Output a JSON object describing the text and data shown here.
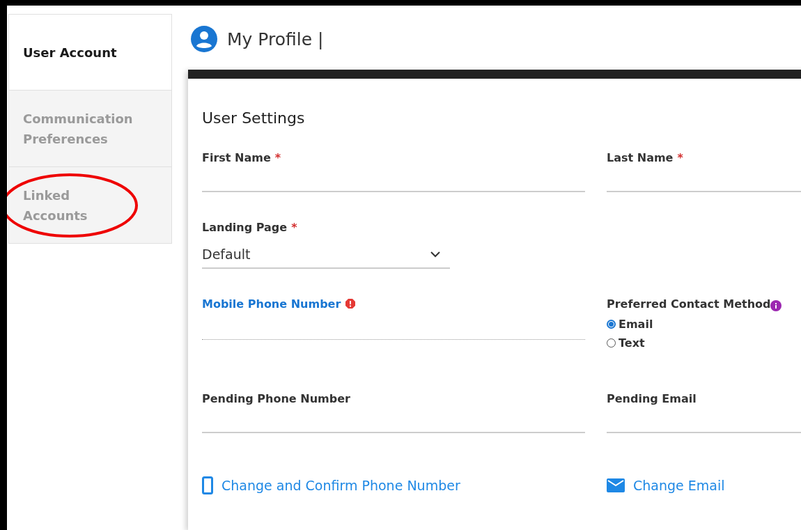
{
  "sidebar": {
    "tabs": [
      {
        "label": "User Account",
        "selected": true
      },
      {
        "label": "Communication Preferences",
        "selected": false
      },
      {
        "label": "Linked Accounts",
        "selected": false
      }
    ]
  },
  "header": {
    "title": "My Profile |"
  },
  "card": {
    "title": "User Settings",
    "rows": [
      {
        "left": {
          "kind": "text",
          "label": "First Name",
          "required_mark": "*",
          "invalid": false
        },
        "right": {
          "kind": "text",
          "label": "Last Name",
          "required_mark": "*",
          "invalid": false
        }
      },
      {
        "left": {
          "kind": "select",
          "label": "Landing Page",
          "required_mark": "*",
          "value": "Default",
          "invalid": false
        }
      },
      {
        "left": {
          "kind": "text",
          "label": "Mobile Phone Number",
          "invalid": true
        },
        "right": {
          "kind": "radio",
          "label": "Preferred Contact Method",
          "options": [
            {
              "label": "Email",
              "selected": true
            },
            {
              "label": "Text",
              "selected": false
            }
          ]
        }
      },
      {
        "left": {
          "kind": "text",
          "label": "Pending Phone Number",
          "invalid": false
        },
        "right": {
          "kind": "text",
          "label": "Pending Email",
          "invalid": false
        }
      }
    ],
    "links": [
      {
        "kind": "phone",
        "label": "Change and Confirm Phone Number"
      },
      {
        "kind": "email",
        "label": "Change Email"
      }
    ]
  },
  "annotation": {
    "kind": "ellipse"
  }
}
